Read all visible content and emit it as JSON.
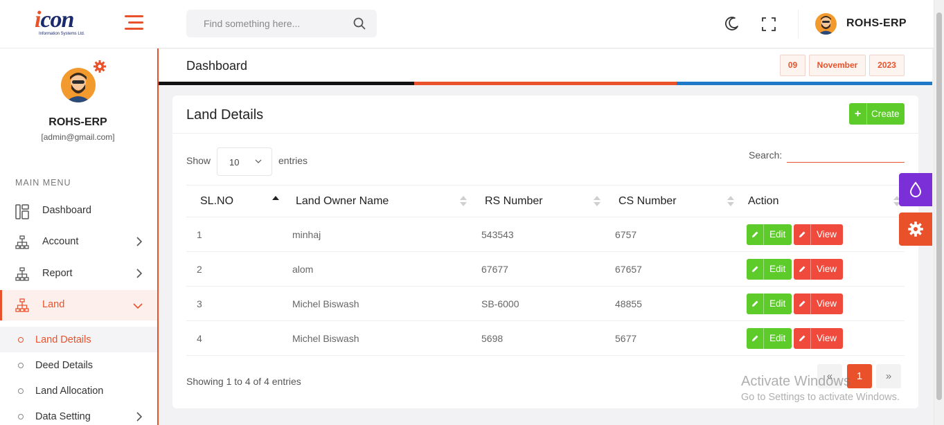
{
  "header": {
    "logo_text_i": "i",
    "logo_text_rest": "con",
    "logo_tagline": "Information Systems Ltd.",
    "search_placeholder": "Find something here...",
    "user_name": "ROHS-ERP"
  },
  "sidebar": {
    "user_name": "ROHS-ERP",
    "user_email": "[admin@gmail.com]",
    "menu_heading": "MAIN MENU",
    "items": [
      {
        "label": "Dashboard"
      },
      {
        "label": "Account"
      },
      {
        "label": "Report"
      },
      {
        "label": "Land"
      }
    ],
    "sub_items": [
      {
        "label": "Land Details"
      },
      {
        "label": "Deed Details"
      },
      {
        "label": "Land Allocation"
      },
      {
        "label": "Data Setting"
      }
    ]
  },
  "page": {
    "title": "Dashboard",
    "date_day": "09",
    "date_month": "November",
    "date_year": "2023"
  },
  "card": {
    "title": "Land Details",
    "create_label": "Create",
    "show_label": "Show",
    "entries_value": "10",
    "entries_label": "entries",
    "search_label": "Search:",
    "columns": [
      "SL.NO",
      "Land Owner Name",
      "RS Number",
      "CS Number",
      "Action"
    ],
    "rows": [
      {
        "sl": "1",
        "owner": "minhaj",
        "rs": "543543",
        "cs": "6757"
      },
      {
        "sl": "2",
        "owner": "alom",
        "rs": "67677",
        "cs": "67657"
      },
      {
        "sl": "3",
        "owner": "Michel Biswash",
        "rs": "SB-6000",
        "cs": "48855"
      },
      {
        "sl": "4",
        "owner": "Michel Biswash",
        "rs": "5698",
        "cs": "5677"
      }
    ],
    "edit_label": "Edit",
    "view_label": "View",
    "showing_text": "Showing 1 to 4 of 4 entries",
    "pagination": {
      "prev": "«",
      "current": "1",
      "next": "»"
    }
  },
  "watermark": {
    "line1": "Activate Windows",
    "line2": "Go to Settings to activate Windows."
  },
  "colors": {
    "accent": "#e8512a",
    "success": "#5dcb2a",
    "danger": "#ef4a3c",
    "purple": "#7b2fd6"
  }
}
